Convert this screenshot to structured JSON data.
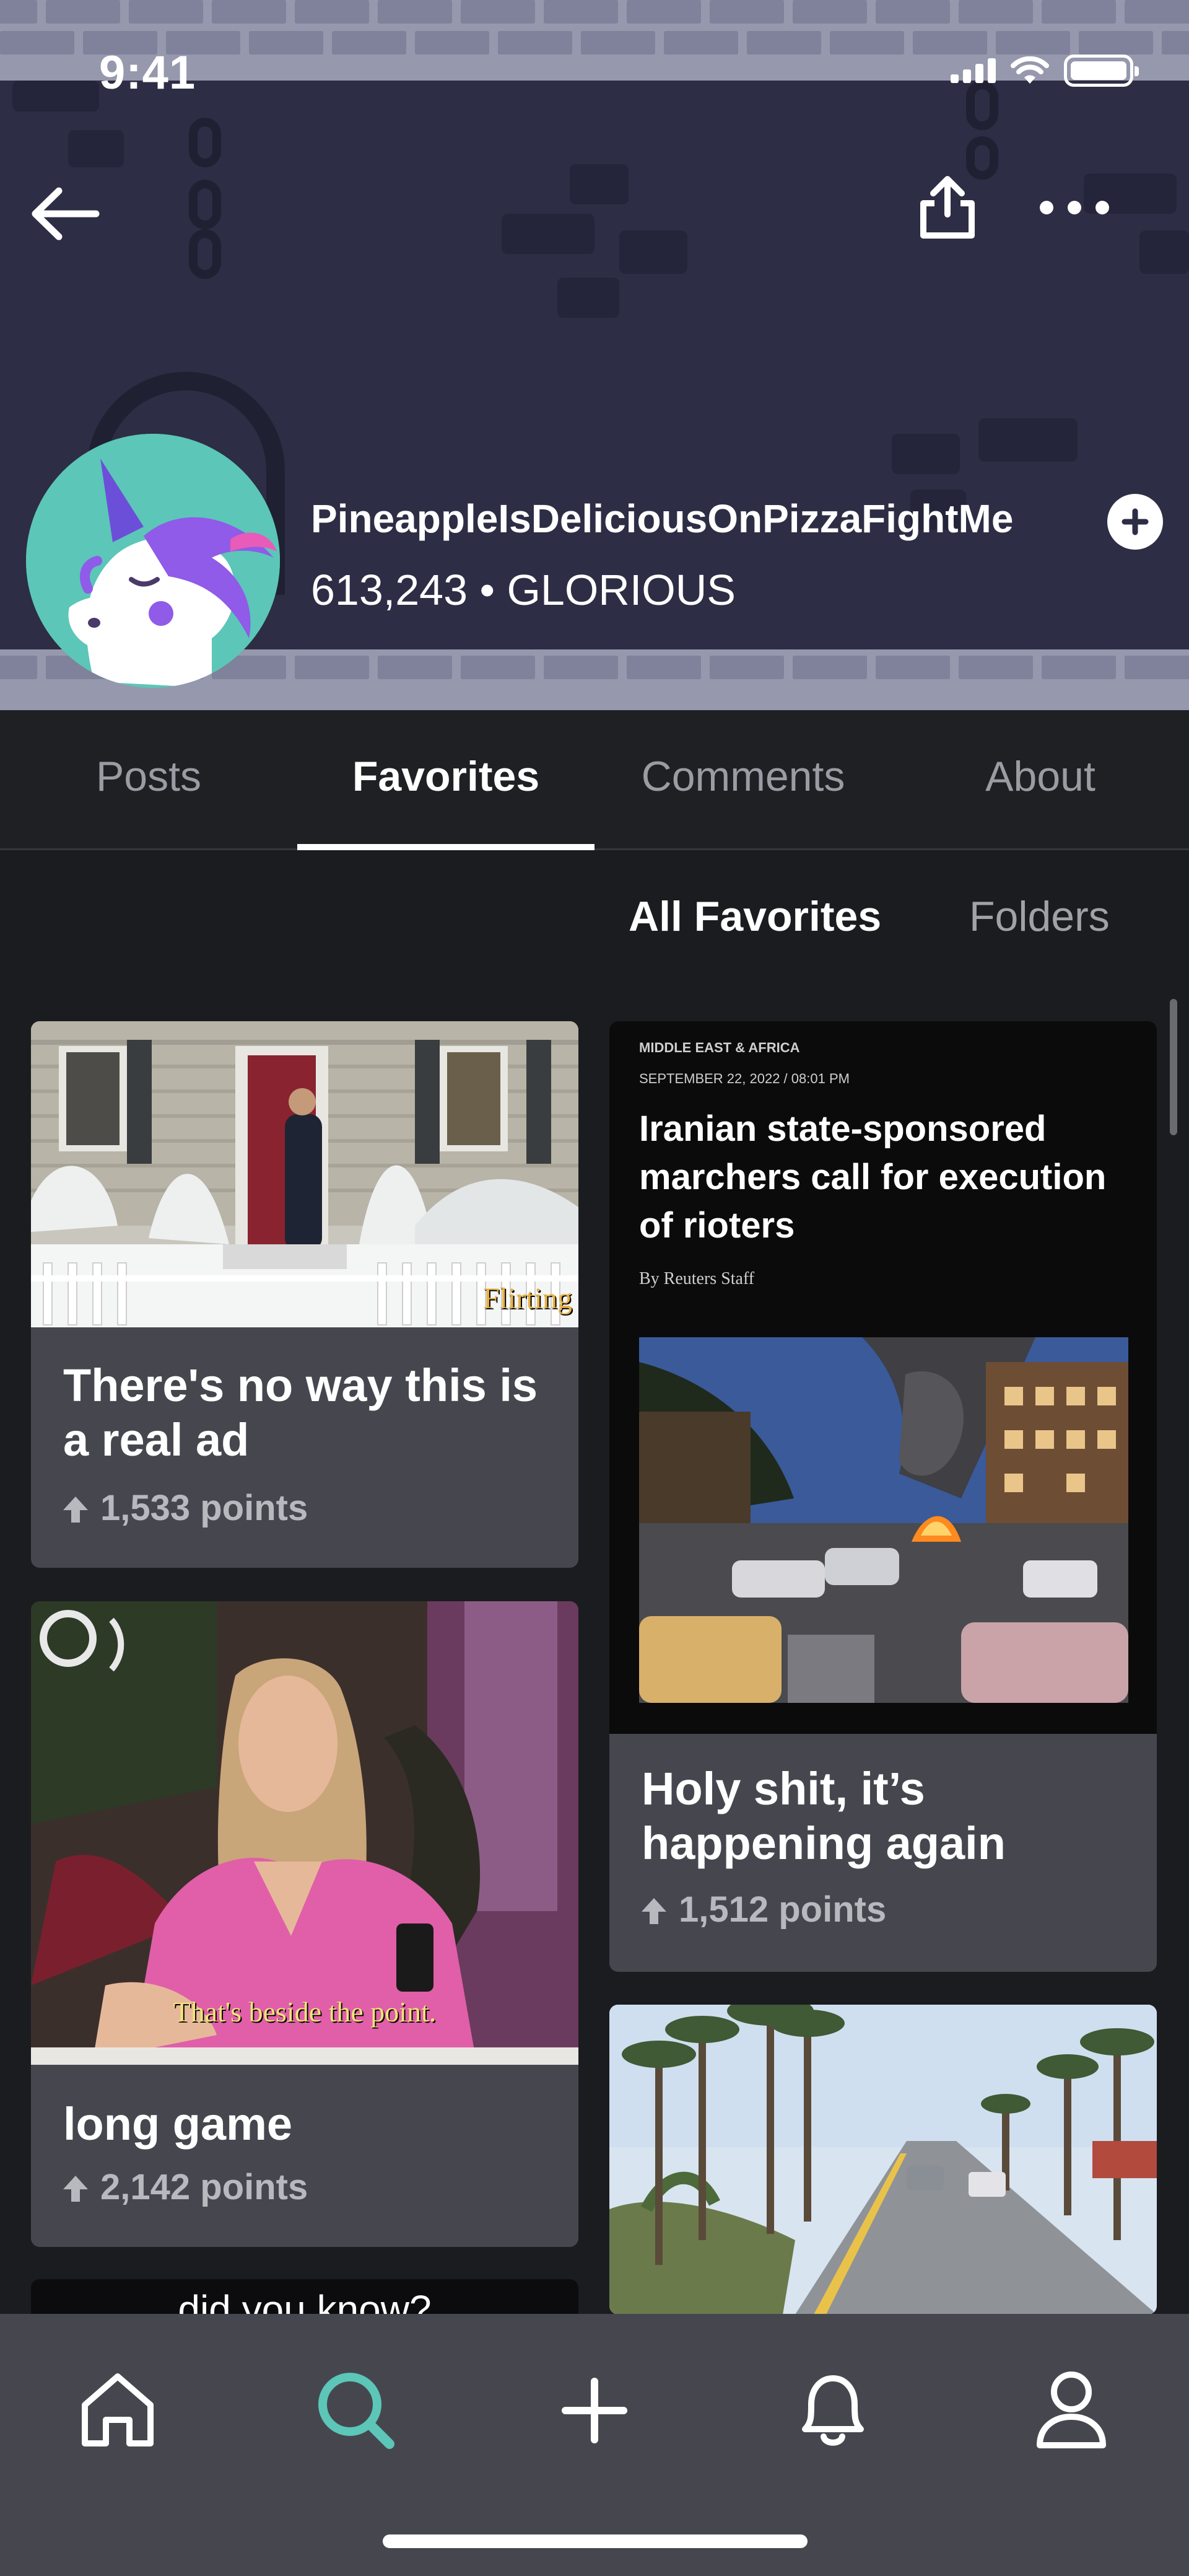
{
  "status_bar": {
    "time": "9:41"
  },
  "profile": {
    "username": "PineappleIsDeliciousOnPizzaFightMe",
    "points": "613,243",
    "separator": "•",
    "rank": "GLORIOUS"
  },
  "tabs": [
    {
      "label": "Posts"
    },
    {
      "label": "Favorites",
      "active": true
    },
    {
      "label": "Comments"
    },
    {
      "label": "About"
    }
  ],
  "subtabs": {
    "all": "All Favorites",
    "folders": "Folders"
  },
  "posts": [
    {
      "title": "There's no way this is a real ad",
      "points": "1,533 points",
      "watermark": "Flirting"
    },
    {
      "title": "long game",
      "points": "2,142 points",
      "caption": "That's beside the point."
    },
    {
      "title": "Holy shit, it’s happening again",
      "points": "1,512 points",
      "news": {
        "section": "MIDDLE EAST & AFRICA",
        "date": "SEPTEMBER 22, 2022 / 08:01 PM",
        "headline": "Iranian state-sponsored marchers call for execution of rioters",
        "byline": "By Reuters Staff"
      }
    },
    {
      "title": "",
      "points": ""
    },
    {
      "caption": "did you know?"
    }
  ],
  "icons": {
    "back": "arrow-left-icon",
    "share": "share-icon",
    "more": "more-icon",
    "follow": "plus-icon",
    "nav": [
      "home-icon",
      "search-icon",
      "plus-icon",
      "bell-icon",
      "profile-icon"
    ]
  },
  "colors": {
    "header_bg": "#2d2d45",
    "brick": "#9698ad",
    "avatar_bg": "#5cc6b8",
    "accent_search": "#5cc6b8",
    "card_bg": "#46474e",
    "page_bg": "#1b1c20"
  }
}
